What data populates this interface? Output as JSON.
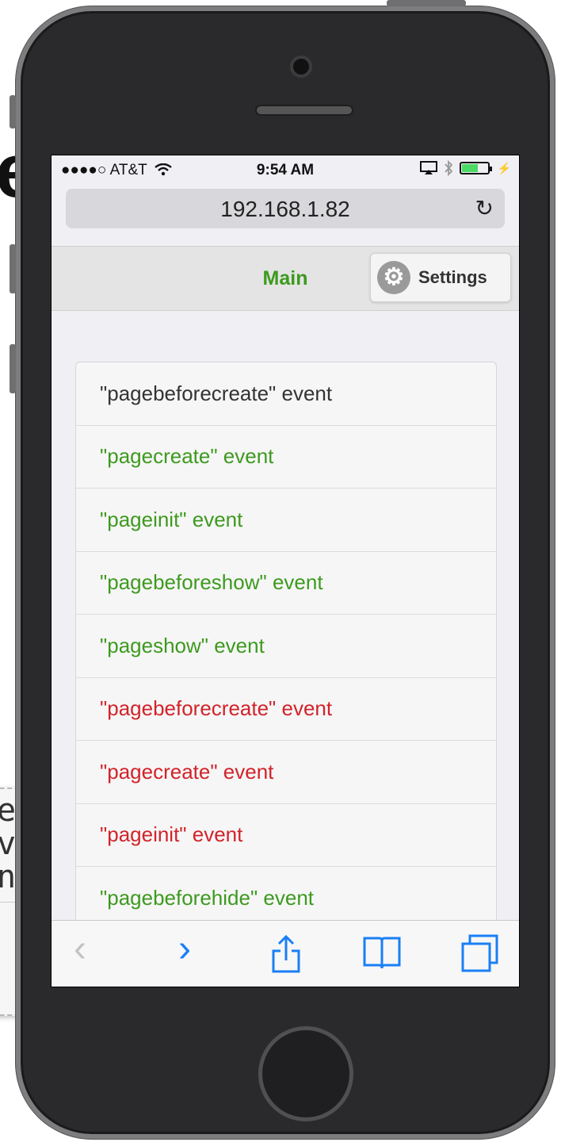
{
  "background": {
    "big_letter": "e",
    "fragment_lines": [
      "e\"",
      "ve",
      "nt"
    ]
  },
  "status_bar": {
    "carrier": "●●●●○ AT&T",
    "time": "9:54 AM"
  },
  "browser": {
    "url": "192.168.1.82",
    "reload_icon": "↻",
    "back_icon": "‹",
    "forward_icon": "›"
  },
  "header": {
    "title": "Main",
    "settings_label": "Settings"
  },
  "events": [
    {
      "label": "\"pagebeforecreate\" event",
      "color": "#333333"
    },
    {
      "label": "\"pagecreate\" event",
      "color": "#3d9a1f"
    },
    {
      "label": "\"pageinit\" event",
      "color": "#3d9a1f"
    },
    {
      "label": "\"pagebeforeshow\" event",
      "color": "#3d9a1f"
    },
    {
      "label": "\"pageshow\" event",
      "color": "#3d9a1f"
    },
    {
      "label": "\"pagebeforecreate\" event",
      "color": "#d2232a"
    },
    {
      "label": "\"pagecreate\" event",
      "color": "#d2232a"
    },
    {
      "label": "\"pageinit\" event",
      "color": "#d2232a"
    },
    {
      "label": "\"pagebeforehide\" event",
      "color": "#3d9a1f"
    }
  ],
  "colors": {
    "accent_green": "#3d9a1f",
    "accent_red": "#d2232a",
    "ios_blue": "#1a7ff5"
  }
}
